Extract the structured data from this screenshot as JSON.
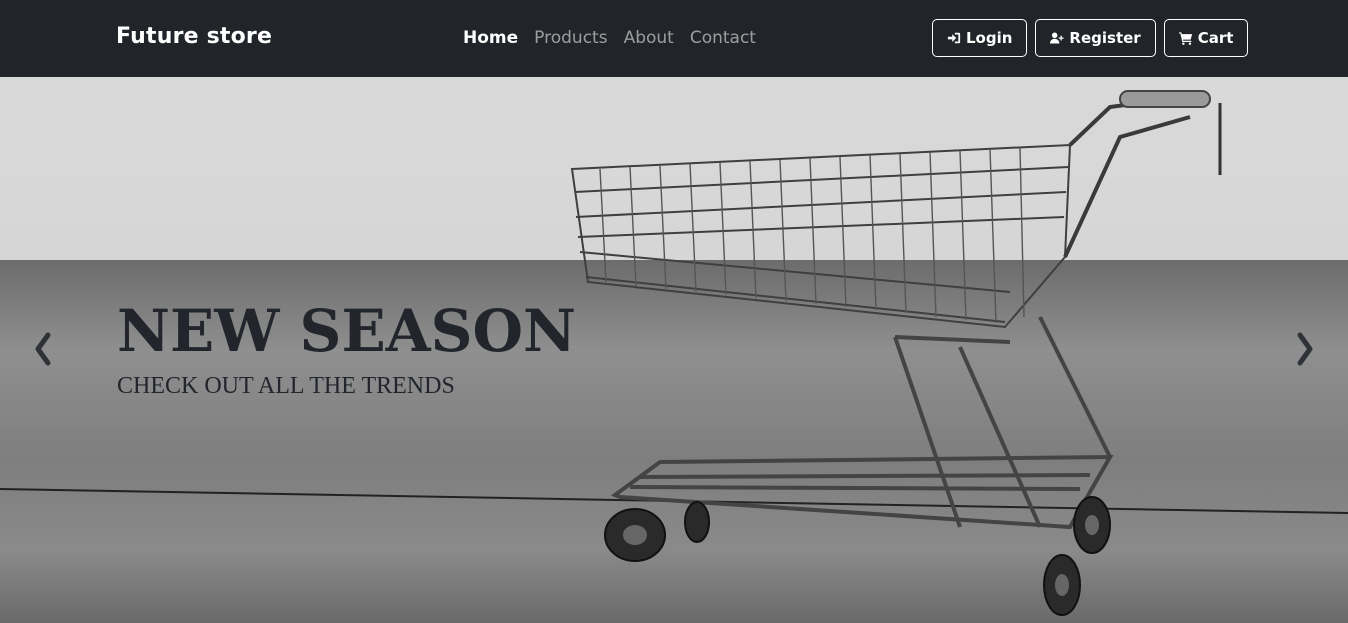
{
  "brand": "Future store",
  "nav": {
    "links": [
      {
        "label": "Home",
        "active": true
      },
      {
        "label": "Products",
        "active": false
      },
      {
        "label": "About",
        "active": false
      },
      {
        "label": "Contact",
        "active": false
      }
    ]
  },
  "actions": {
    "login": {
      "label": "Login",
      "icon": "login-icon"
    },
    "register": {
      "label": "Register",
      "icon": "user-plus-icon"
    },
    "cart": {
      "label": "Cart",
      "icon": "cart-icon"
    }
  },
  "hero": {
    "title": "NEW SEASON",
    "subtitle": "CHECK OUT ALL THE TRENDS",
    "image": "shopping-cart-photo",
    "prev_icon": "chevron-left-icon",
    "next_icon": "chevron-right-icon"
  },
  "colors": {
    "navbar_bg": "#212529",
    "caption_text": "#22262c",
    "nav_muted": "rgba(255,255,255,0.55)"
  }
}
